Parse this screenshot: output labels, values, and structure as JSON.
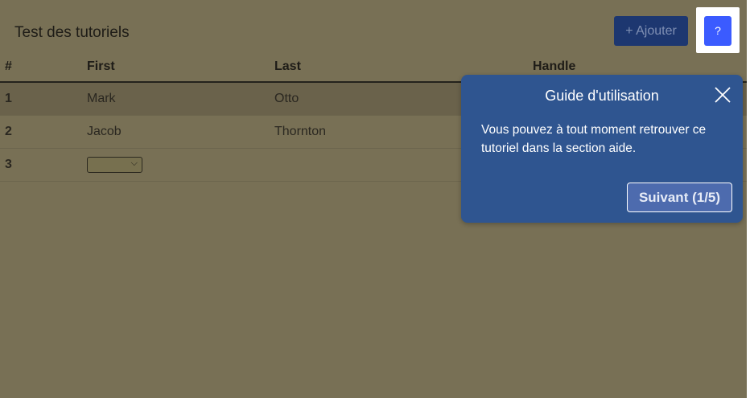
{
  "page": {
    "title": "Test des tutoriels"
  },
  "toolbar": {
    "add_label": "+ Ajouter",
    "help_label": "?"
  },
  "table": {
    "headers": [
      "#",
      "First",
      "Last",
      "Handle"
    ],
    "rows": [
      {
        "num": "1",
        "first": "Mark",
        "last": "Otto",
        "handle": ""
      },
      {
        "num": "2",
        "first": "Jacob",
        "last": "Thornton",
        "handle": ""
      },
      {
        "num": "3",
        "first": "",
        "last": "",
        "handle": ""
      }
    ]
  },
  "tutorial": {
    "title": "Guide d'utilisation",
    "body": "Vous pouvez à tout moment retrouver ce tutoriel dans la section aide.",
    "next_label": "Suivant (1/5)"
  },
  "icons": {
    "close": "close-icon",
    "dropdown": "chevron-down-icon"
  },
  "colors": {
    "overlay": "#787055",
    "popover": "#2f5590",
    "help_button": "#3b5bff",
    "add_button": "#1d3770"
  }
}
